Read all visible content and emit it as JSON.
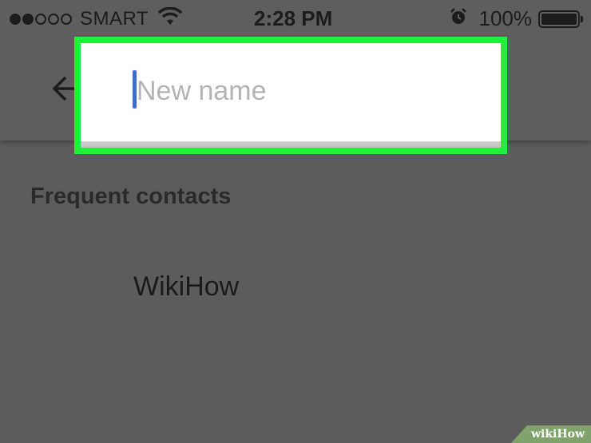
{
  "status_bar": {
    "signal_dots_filled": 2,
    "signal_dots_total": 5,
    "carrier": "SMART",
    "time": "2:28 PM",
    "battery_percent": "100%",
    "icons": [
      "wifi-icon",
      "alarm-icon",
      "battery-icon"
    ]
  },
  "app_bar": {
    "back_icon": "back-arrow-icon"
  },
  "dialog": {
    "input_value": "",
    "input_placeholder": "New name"
  },
  "content": {
    "section_title": "Frequent contacts",
    "contacts": [
      "WikiHow"
    ]
  },
  "watermark": {
    "brand": "wikiHow"
  },
  "colors": {
    "highlight": "#22ef3a",
    "caret": "#3d6bdc",
    "overlay_bg": "#5c5c5c"
  }
}
